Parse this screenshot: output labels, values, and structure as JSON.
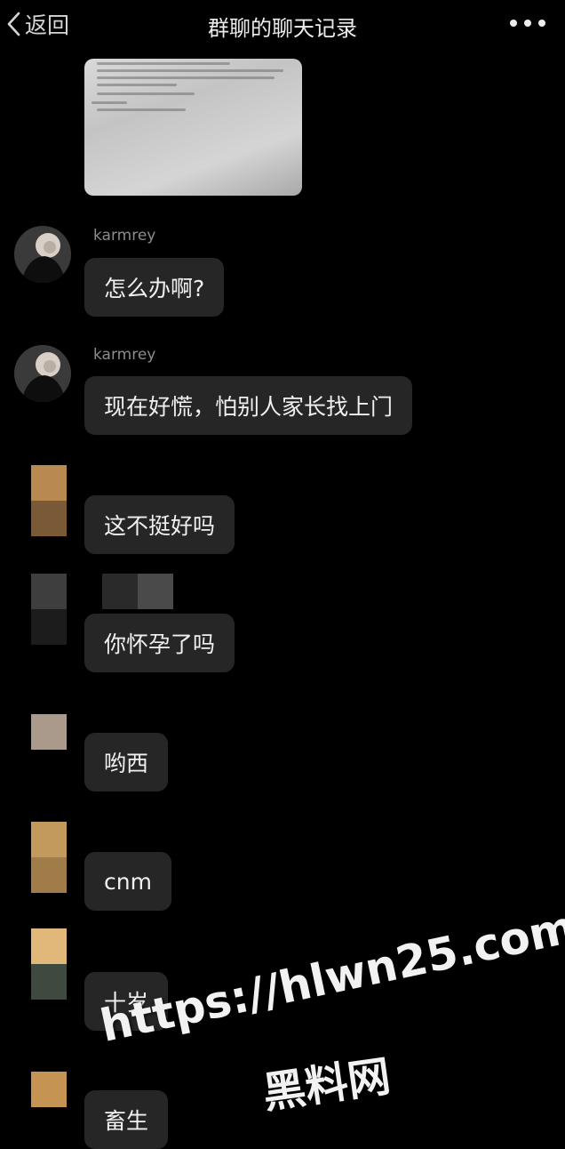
{
  "header": {
    "back_label": "返回",
    "title": "群聊的聊天记录",
    "more_icon": "more-dots-icon"
  },
  "messages": [
    {
      "sender": "karmrey",
      "text": "怎么办啊?"
    },
    {
      "sender": "karmrey",
      "text": "现在好慌，怕别人家长找上门"
    },
    {
      "text": "这不挺好吗"
    },
    {
      "text": "你怀孕了吗"
    },
    {
      "text": "哟西"
    },
    {
      "text": "cnm"
    },
    {
      "text": "十岁"
    },
    {
      "text": "畜生"
    }
  ],
  "watermark": {
    "url": "https://hlwn25.com",
    "name": "黑料网"
  },
  "colors": {
    "background": "#000000",
    "bubble": "#262626",
    "text": "#f0f0f0",
    "nickname": "#8c8c8c"
  }
}
